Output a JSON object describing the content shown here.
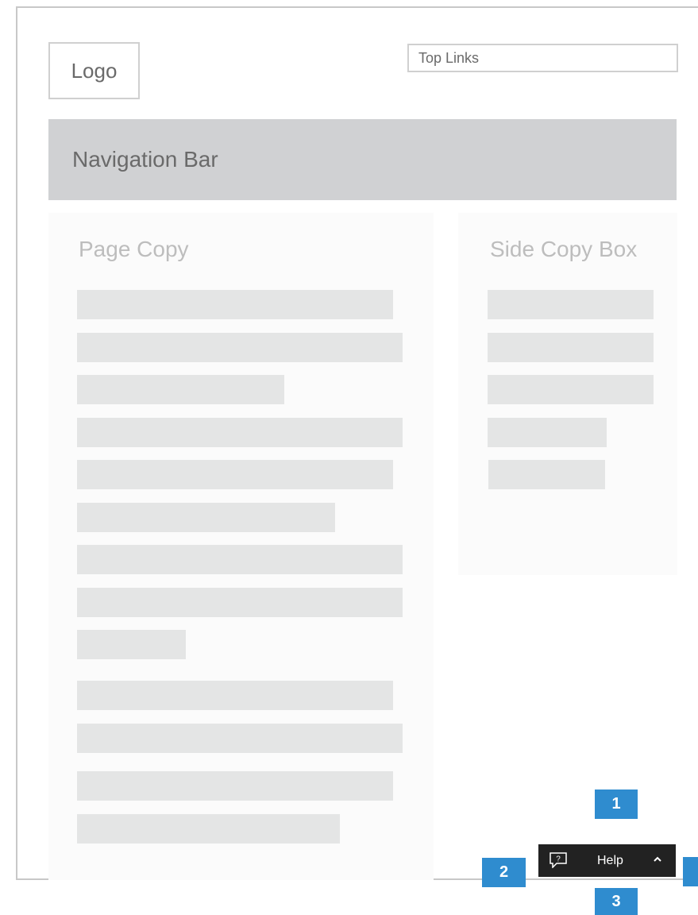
{
  "header": {
    "logo_label": "Logo",
    "top_links_label": "Top Links"
  },
  "navigation": {
    "label": "Navigation Bar"
  },
  "page_copy": {
    "title": "Page Copy",
    "line_count": 13
  },
  "side_copy": {
    "title": "Side Copy Box",
    "line_count": 5
  },
  "help_toolbar": {
    "icon": "question-speech-bubble-icon",
    "label": "Help",
    "chevron_icon": "chevron-up-icon"
  },
  "callouts": [
    "1",
    "2",
    "3",
    ""
  ],
  "colors": {
    "navbar": "#d0d1d3",
    "placeholder_line": "#e4e5e5",
    "help_bar": "#222222",
    "callout": "#2f8ccf"
  }
}
